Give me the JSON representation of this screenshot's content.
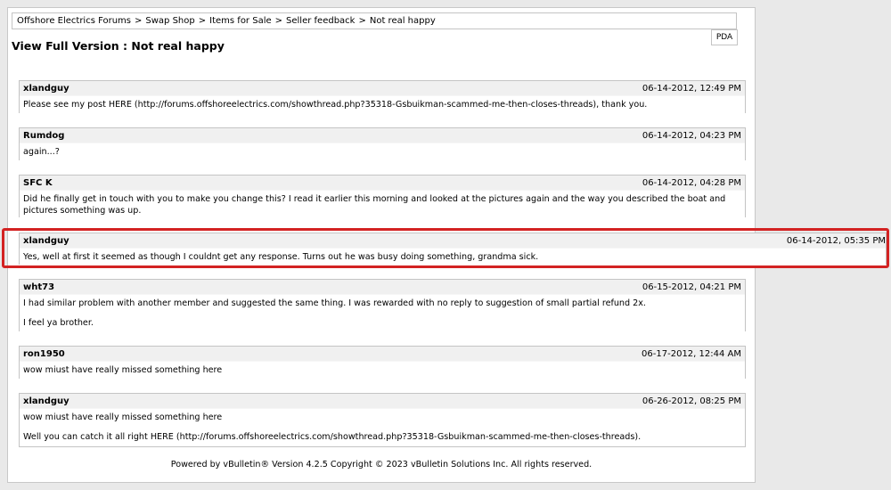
{
  "breadcrumb": [
    "Offshore Electrics Forums",
    "Swap Shop",
    "Items for Sale",
    "Seller feedback",
    "Not real happy"
  ],
  "breadcrumb_separator": ">",
  "pda_label": "PDA",
  "page_title": "View Full Version : Not real happy",
  "posts": [
    {
      "author": "xlandguy",
      "date": "06-14-2012, 12:49 PM",
      "paragraphs": [
        "Please see my post HERE (http://forums.offshoreelectrics.com/showthread.php?35318-Gsbuikman-scammed-me-then-closes-threads), thank you."
      ]
    },
    {
      "author": "Rumdog",
      "date": "06-14-2012, 04:23 PM",
      "paragraphs": [
        "again...?"
      ]
    },
    {
      "author": "SFC K",
      "date": "06-14-2012, 04:28 PM",
      "paragraphs": [
        "Did he finally get in touch with you to make you change this? I read it earlier this morning and looked at the pictures again and the way you described the boat and pictures something was up."
      ]
    },
    {
      "author": "xlandguy",
      "date": "06-14-2012, 05:35 PM",
      "paragraphs": [
        "Yes, well at first it seemed as though I couldnt get any response. Turns out he was busy doing something, grandma sick."
      ]
    },
    {
      "author": "wht73",
      "date": "06-15-2012, 04:21 PM",
      "paragraphs": [
        "I had similar problem with another member and suggested the same thing. I was rewarded with no reply to suggestion of small partial refund 2x.",
        "I feel ya brother."
      ]
    },
    {
      "author": "ron1950",
      "date": "06-17-2012, 12:44 AM",
      "paragraphs": [
        "wow miust have really missed something here"
      ]
    },
    {
      "author": "xlandguy",
      "date": "06-26-2012, 08:25 PM",
      "paragraphs": [
        "wow miust have really missed something here",
        "Well you can catch it all right HERE (http://forums.offshoreelectrics.com/showthread.php?35318-Gsbuikman-scammed-me-then-closes-threads)."
      ]
    }
  ],
  "footer": "Powered by vBulletin® Version 4.2.5 Copyright © 2023 vBulletin Solutions Inc. All rights reserved.",
  "colors": {
    "highlight_border": "#d32222",
    "post_header_bg": "#f0f0f0",
    "border": "#c4c4c4"
  }
}
